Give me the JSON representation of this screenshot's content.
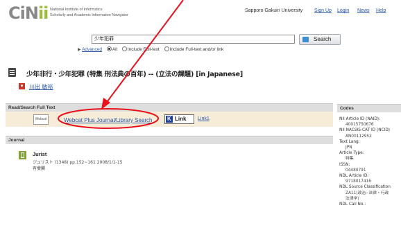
{
  "header": {
    "logo_main": "CiN",
    "logo_accent": "ii",
    "institute_line1": "National Institute of Informatics",
    "institute_line2": "Scholarly and Academic Information Navigator",
    "university": "Sapporo Gakuin University",
    "links": [
      "Sign Up",
      "Login",
      "News",
      "Help"
    ]
  },
  "search": {
    "query": "少年犯罪",
    "button_label": "Search",
    "advanced_label": "Advanced",
    "options": [
      "All",
      "Include Full-text",
      "Include Full-text and/or link"
    ],
    "selected_option": "All"
  },
  "article": {
    "title": "少年非行・少年犯罪 (特集 刑法典の百年) -- (立法の課題) [in Japanese]",
    "author": "川出 敏裕"
  },
  "fulltext": {
    "section_label": "Read/Search Full Text",
    "webcat_icon_label": "Webcat",
    "webcat_link": "Webcat Plus Journal/Library Search",
    "link_button": "Link",
    "link1": "Link1"
  },
  "journal": {
    "section_label": "Journal",
    "name": "Jurist",
    "meta": "ジュリスト (1348) pp.152~161 2008/1/1-15",
    "publisher": "有斐閣"
  },
  "codes": {
    "section_label": "Codes",
    "entries": [
      {
        "label": "NII Article ID (NAID):",
        "value": "40015750676"
      },
      {
        "label": "NII NACSIS-CAT ID (NCID)",
        "value": "AN00112952"
      },
      {
        "label": "Text Lang:",
        "value": "JPN"
      },
      {
        "label": "Article Type:",
        "value": "特集"
      },
      {
        "label": "ISSN:",
        "value": "04480791"
      },
      {
        "label": "NDL Article ID:",
        "value": "9718017416"
      },
      {
        "label": "NDL Source Classification",
        "value": "ZA11(政治--法律・行政"
      },
      {
        "label": "",
        "value": "法律学)"
      },
      {
        "label": "NDL Call No.:",
        "value": ""
      }
    ]
  },
  "colors": {
    "link": "#2a57a8",
    "annotation": "#e8101a",
    "fulltext_bg": "#f6ecd8",
    "section_bar": "#dedede"
  }
}
